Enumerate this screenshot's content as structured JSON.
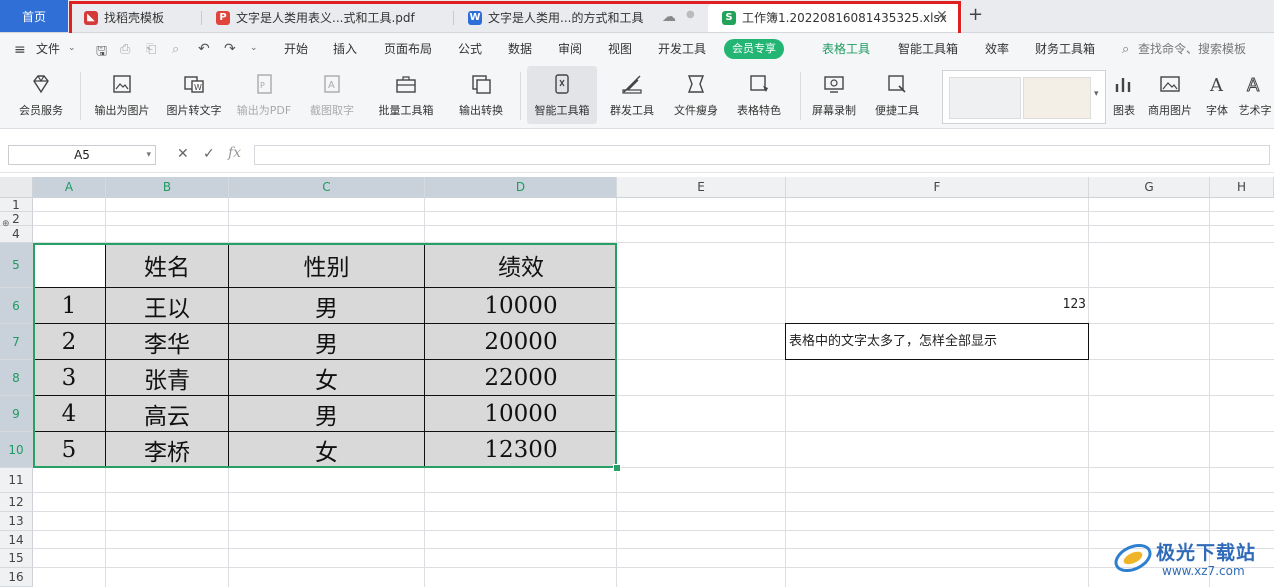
{
  "tabs": {
    "home": "首页",
    "items": [
      {
        "label": "找稻壳模板",
        "icon": "daoke-icon",
        "color": "#d43a3a"
      },
      {
        "label": "文字是人类用表义...式和工具.pdf",
        "icon": "pdf-icon",
        "color": "#e0443b"
      },
      {
        "label": "文字是人类用...的方式和工具",
        "icon": "wps-writer-icon",
        "color": "#2d6fd6"
      },
      {
        "label": "工作簿1.20220816081435325.xlsx",
        "icon": "wps-sheet-icon",
        "color": "#22a35a"
      }
    ],
    "add": "+"
  },
  "menu": {
    "file": "文件",
    "items": [
      "开始",
      "插入",
      "页面布局",
      "公式",
      "数据",
      "审阅",
      "视图",
      "开发工具"
    ],
    "vip": "会员专享",
    "active": "表格工具",
    "more": [
      "智能工具箱",
      "效率",
      "财务工具箱"
    ],
    "search": "查找命令、搜索模板"
  },
  "ribbon": {
    "items": [
      "会员服务",
      "输出为图片",
      "图片转文字",
      "输出为PDF",
      "截图取字",
      "批量工具箱",
      "输出转换",
      "智能工具箱",
      "群发工具",
      "文件瘦身",
      "表格特色",
      "屏幕录制",
      "便捷工具",
      "图表",
      "商用图片",
      "字体",
      "艺术字"
    ]
  },
  "formula": {
    "cell_ref": "A5",
    "fx": "fx",
    "value": ""
  },
  "grid": {
    "columns": [
      "A",
      "B",
      "C",
      "D",
      "E",
      "F",
      "G",
      "H"
    ],
    "rows": [
      "1",
      "2",
      "4",
      "5",
      "6",
      "7",
      "8",
      "9",
      "10",
      "11",
      "12",
      "13",
      "14",
      "15",
      "16"
    ],
    "table": {
      "header": [
        "",
        "姓名",
        "性别",
        "绩效"
      ],
      "rows": [
        [
          "1",
          "王以",
          "男",
          "10000"
        ],
        [
          "2",
          "李华",
          "男",
          "20000"
        ],
        [
          "3",
          "张青",
          "女",
          "22000"
        ],
        [
          "4",
          "高云",
          "男",
          "10000"
        ],
        [
          "5",
          "李桥",
          "女",
          "12300"
        ]
      ]
    },
    "f6": "123",
    "f7": "表格中的文字太多了，怎样全部显示"
  },
  "watermark": {
    "title": "极光下载站",
    "url": "www.xz7.com"
  },
  "colors": {
    "accent": "#27a065",
    "highlight_box": "#e02020",
    "home_tab": "#2f6fd6",
    "vip": "#22b573"
  }
}
